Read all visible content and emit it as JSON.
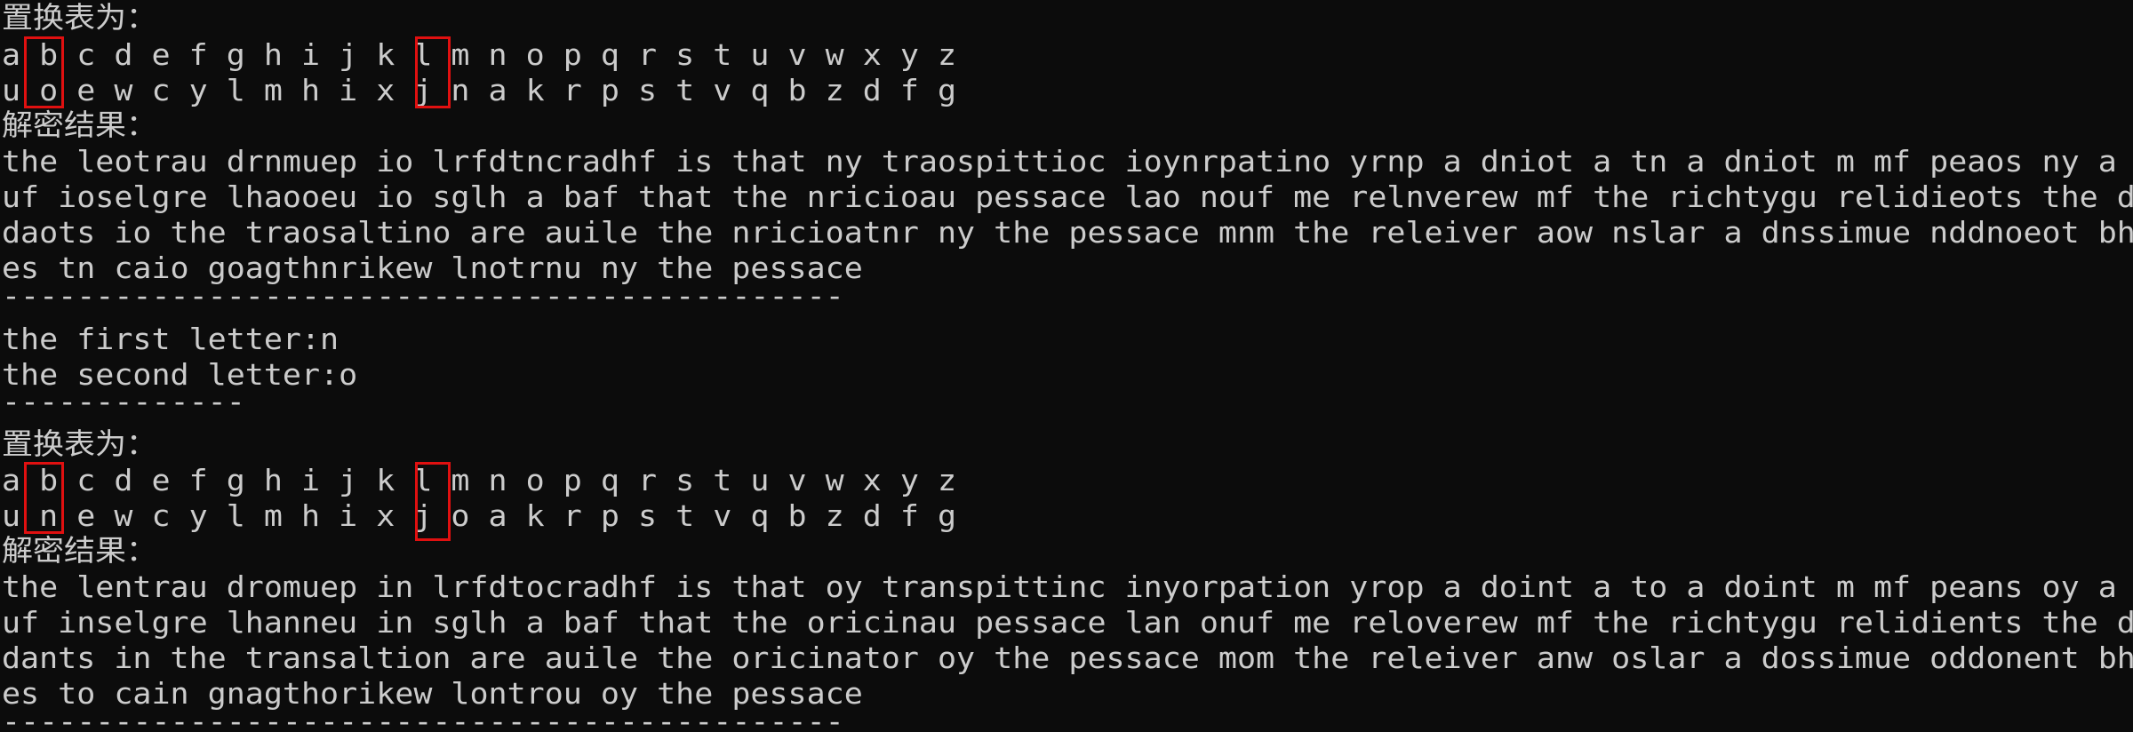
{
  "block1": {
    "table_label": "置换表为：",
    "plain_row": "a b c d e f g h i j k l m n o p q r s t u v w x y z",
    "cipher_row": "u o e w c y l m h i x j n a k r p s t v q b z d f g",
    "result_label": "解密结果：",
    "result_lines": [
      "the leotrau drnmuep io lrfdtncradhf is that ny traospittioc ioynrpatino yrnp a dniot a tn a dniot m mf peaos ny a dnssim",
      "uf ioselgre lhaooeu io sglh a baf that the nricioau pessace lao nouf me relnverew mf the richtygu relidieots the dartili",
      "daots io the traosaltino are auile the nricioatnr ny the pessace mnm the releiver aow nslar a dnssimue nddnoeot bhn bish",
      "es tn caio goagthnrikew lnotrnu ny the pessace"
    ],
    "separator": "---------------------------------------------"
  },
  "letters": {
    "first": "the first letter:n",
    "second": "the second letter:o",
    "separator": "-------------"
  },
  "block2": {
    "table_label": "置换表为：",
    "plain_row": "a b c d e f g h i j k l m n o p q r s t u v w x y z",
    "cipher_row": "u n e w c y l m h i x j o a k r p s t v q b z d f g",
    "result_label": "解密结果：",
    "result_lines": [
      "the lentrau dromuep in lrfdtocradhf is that oy transpittinc inyorpation yrop a doint a to a doint m mf peans oy a dossim",
      "uf inselgre lhanneu in sglh a baf that the oricinau pessace lan onuf me reloverew mf the richtygu relidients the dartili",
      "dants in the transaltion are auile the oricinator oy the pessace mom the releiver anw oslar a dossimue oddonent bho bish",
      "es to cain gnagthorikew lontrou oy the pessace"
    ],
    "separator": "---------------------------------------------"
  },
  "colors": {
    "background": "#0c0c0c",
    "text": "#cccccc",
    "highlight_border": "#e01010"
  }
}
